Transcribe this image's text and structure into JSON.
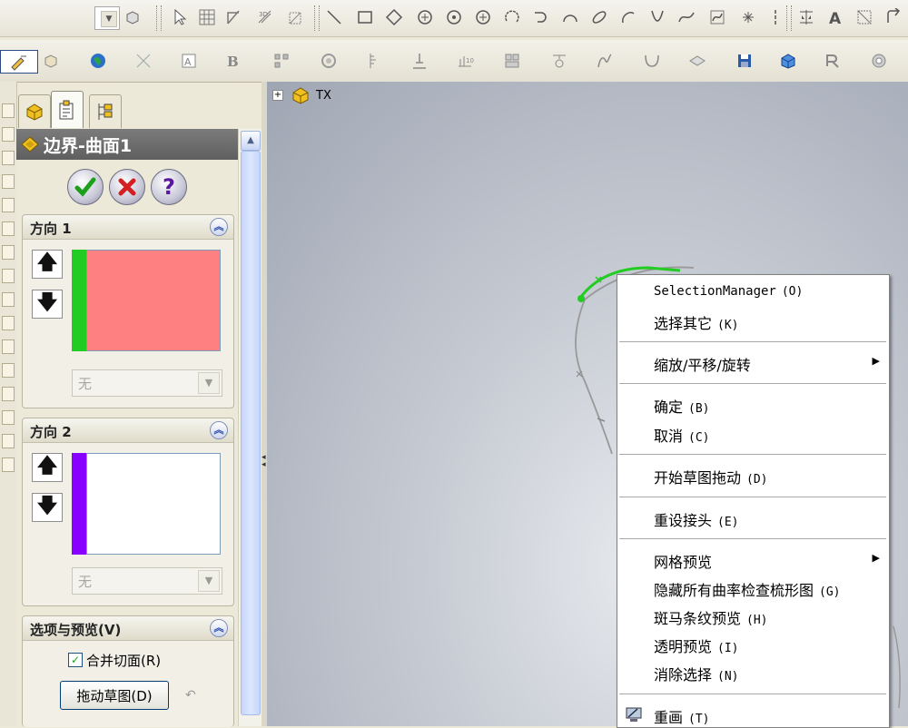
{
  "feature_tree": {
    "expander": "+",
    "root_label": "TX"
  },
  "property_manager": {
    "title": "边界-曲面1",
    "ok_icon": "check-icon",
    "cancel_icon": "x-icon",
    "help_label": "?",
    "direction1": {
      "title": "方向 1",
      "combo_value": "无",
      "color": "#22cc22",
      "selection_fill": "#ff8080"
    },
    "direction2": {
      "title": "方向 2",
      "combo_value": "无",
      "color": "#8800ff",
      "selection_fill": "#ffffff"
    },
    "options": {
      "title": "选项与预览(V)",
      "merge_label": "合并切面(R)",
      "merge_checked": true,
      "drag_button": "拖动草图(D)"
    }
  },
  "context_menu": {
    "items": [
      {
        "label": "SelectionManager",
        "key": "(O)"
      },
      {
        "label": "选择其它",
        "key": "(K)"
      },
      {
        "label": "缩放/平移/旋转",
        "key": "",
        "submenu": true
      },
      {
        "label": "确定",
        "key": "(B)"
      },
      {
        "label": "取消",
        "key": "(C)"
      },
      {
        "label": "开始草图拖动",
        "key": "(D)"
      },
      {
        "label": "重设接头",
        "key": "(E)"
      },
      {
        "label": "网格预览",
        "key": "",
        "submenu": true
      },
      {
        "label": "隐藏所有曲率检查梳形图",
        "key": "(G)"
      },
      {
        "label": "斑马条纹预览",
        "key": "(H)"
      },
      {
        "label": "透明预览",
        "key": "(I)"
      },
      {
        "label": "消除选择",
        "key": "(N)"
      },
      {
        "label": "重画",
        "key": "(T)"
      }
    ]
  },
  "colors": {
    "sketch_curve": "#999999",
    "sketch_highlight": "#22cc22"
  }
}
